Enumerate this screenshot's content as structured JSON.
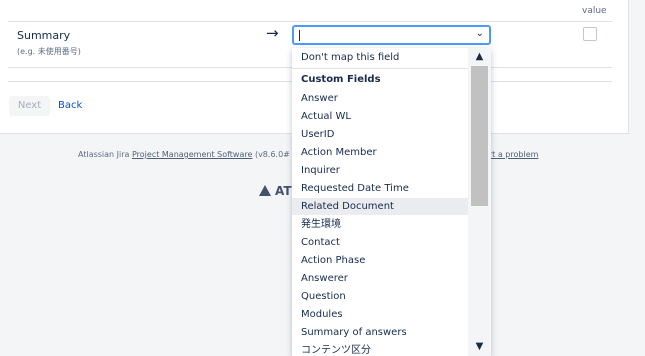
{
  "table": {
    "value_header": "value",
    "row": {
      "label": "Summary",
      "hint": "(e.g. 未使用番号)",
      "arrow": "→"
    }
  },
  "select": {
    "current_value": "",
    "chevron": "⌄"
  },
  "buttons": {
    "next": "Next",
    "back": "Back"
  },
  "footer": {
    "text_prefix": "Atlassian Jira ",
    "link_text": "Project Management Software",
    "version": " (v8.6.0#",
    "report_link": "ort a problem"
  },
  "logo": {
    "text": "AT"
  },
  "dropdown": {
    "none_option": "Don't map this field",
    "group_label": "Custom Fields",
    "options": [
      "Answer",
      "Actual WL",
      "UserID",
      "Action Member",
      "Inquirer",
      "Requested Date Time",
      "Related Document",
      "発生環境",
      "Contact",
      "Action Phase",
      "Answerer",
      "Question",
      "Modules",
      "Summary of answers",
      "コンテンツ区分"
    ],
    "highlighted_option": "Related Document",
    "scroll_up": "▲",
    "scroll_down": "▼"
  },
  "colors": {
    "focus_border": "#4c9aff",
    "link": "#0052cc",
    "hover_bg": "#ebecf0"
  }
}
